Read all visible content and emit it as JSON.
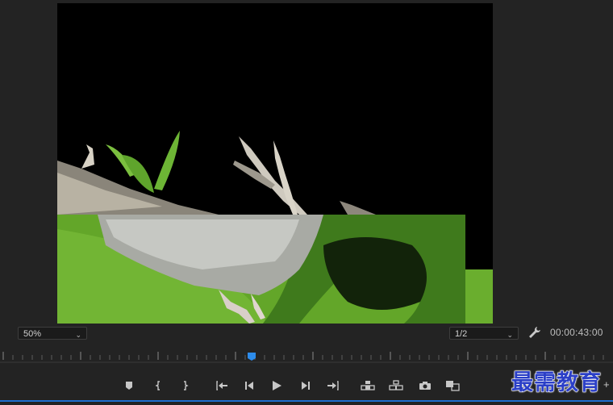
{
  "zoom_select": {
    "value": "50%"
  },
  "resolution_select": {
    "value": "1/2"
  },
  "timecode": "00:00:43:00",
  "playhead_position": 0.41,
  "watermark": "最需教育",
  "transport_controls": [
    {
      "name": "add-marker-button",
      "icon": "marker-icon"
    },
    {
      "name": "mark-in-button",
      "icon": "mark-in-icon"
    },
    {
      "name": "mark-out-button",
      "icon": "mark-out-icon"
    },
    {
      "name": "go-to-in-button",
      "icon": "go-to-in-icon"
    },
    {
      "name": "step-back-button",
      "icon": "step-back-icon"
    },
    {
      "name": "play-button",
      "icon": "play-icon"
    },
    {
      "name": "step-forward-button",
      "icon": "step-forward-icon"
    },
    {
      "name": "go-to-out-button",
      "icon": "go-to-out-icon"
    },
    {
      "name": "lift-button",
      "icon": "lift-icon"
    },
    {
      "name": "extract-button",
      "icon": "extract-icon"
    },
    {
      "name": "export-frame-button",
      "icon": "camera-icon"
    },
    {
      "name": "compare-view-button",
      "icon": "compare-icon"
    },
    {
      "name": "button-editor",
      "icon": "plus-icon"
    }
  ],
  "accent_color": "#2d8ceb"
}
